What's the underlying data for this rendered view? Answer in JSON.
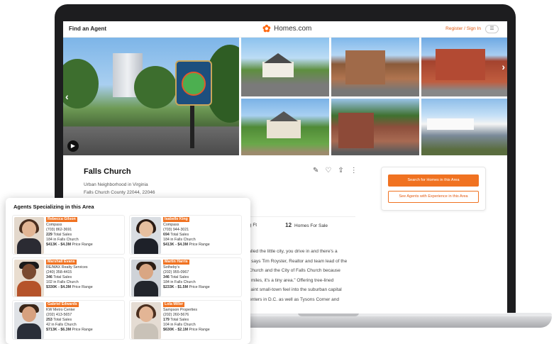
{
  "nav": {
    "left_link": "Find an Agent",
    "logo_text": "Homes.com",
    "auth_link": "Register / Sign In",
    "avatar_icon": "user-icon"
  },
  "gallery": {
    "prev_icon": "chevron-left-icon",
    "next_icon": "chevron-right-icon",
    "play_icon": "play-icon"
  },
  "area": {
    "name": "Falls Church",
    "type": "Urban Neighborhood in Virginia",
    "location": "Falls Church County 22044, 22046",
    "action_icons": [
      "edit-note-icon",
      "heart-icon",
      "share-icon",
      "more-vertical-icon"
    ]
  },
  "cta": {
    "primary": "Search for Homes in this Area",
    "secondary": "See Agents with Experience in this Area"
  },
  "stats": {
    "sqft_label": "er Sq Ft",
    "homes_count": "12",
    "homes_label": "Homes For Sale"
  },
  "description": [
    "t’s called the little city, you drive in and there’s a",
    "ure,” says Tim Royster, Realtor and team lead of the",
    "alls Church and the City of Falls Church because",
    "uare miles, it’s a tiny area.” Offering tree-lined",
    "at quaint small-town feel into the suburban capital",
    "ob centers in D.C. as well as Tysons Corner and"
  ],
  "agents_panel": {
    "title": "Agents Specializing in this Area",
    "agents": [
      {
        "name": "Rebecca Gilson",
        "company": "Compass",
        "phone": "(703) 862-3691",
        "total": "229",
        "total_label": "Total Sales",
        "local": "184",
        "local_label": "in Falls Church",
        "range": "$413K - $4.3M",
        "range_label": "Price Range"
      },
      {
        "name": "Isabelle King",
        "company": "Compass",
        "phone": "(703) 944-3021",
        "total": "694",
        "total_label": "Total Sales",
        "local": "184",
        "local_label": "in Falls Church",
        "range": "$413K - $4.3M",
        "range_label": "Price Range"
      },
      {
        "name": "Marshall Evans",
        "company": "RE/MAX Realty Services",
        "phone": "(240) 358-4415",
        "total": "346",
        "total_label": "Total Sales",
        "local": "102",
        "local_label": "in Falls Church",
        "range": "$330K - $4.3M",
        "range_label": "Price Range"
      },
      {
        "name": "Martin Harris",
        "company": "Sotheby’s",
        "phone": "(202) 955-0967",
        "total": "346",
        "total_label": "Total Sales",
        "local": "184",
        "local_label": "in Falls Church",
        "range": "$233K - $1.5M",
        "range_label": "Price Range"
      },
      {
        "name": "Gabriel Edwards",
        "company": "KW Metro Center",
        "phone": "(202) 413-5657",
        "total": "253",
        "total_label": "Total Sales",
        "local": "42",
        "local_label": "in Falls Church",
        "range": "$713K - $6.3M",
        "range_label": "Price Range"
      },
      {
        "name": "Lola Miller",
        "company": "Sampson Properties",
        "phone": "(202) 260-5676",
        "total": "179",
        "total_label": "Total Sales",
        "local": "104",
        "local_label": "in Falls Church",
        "range": "$630K - $2.1M",
        "range_label": "Price Range"
      }
    ]
  },
  "colors": {
    "accent": "#f07221",
    "laptop": "#1d1d1f"
  }
}
